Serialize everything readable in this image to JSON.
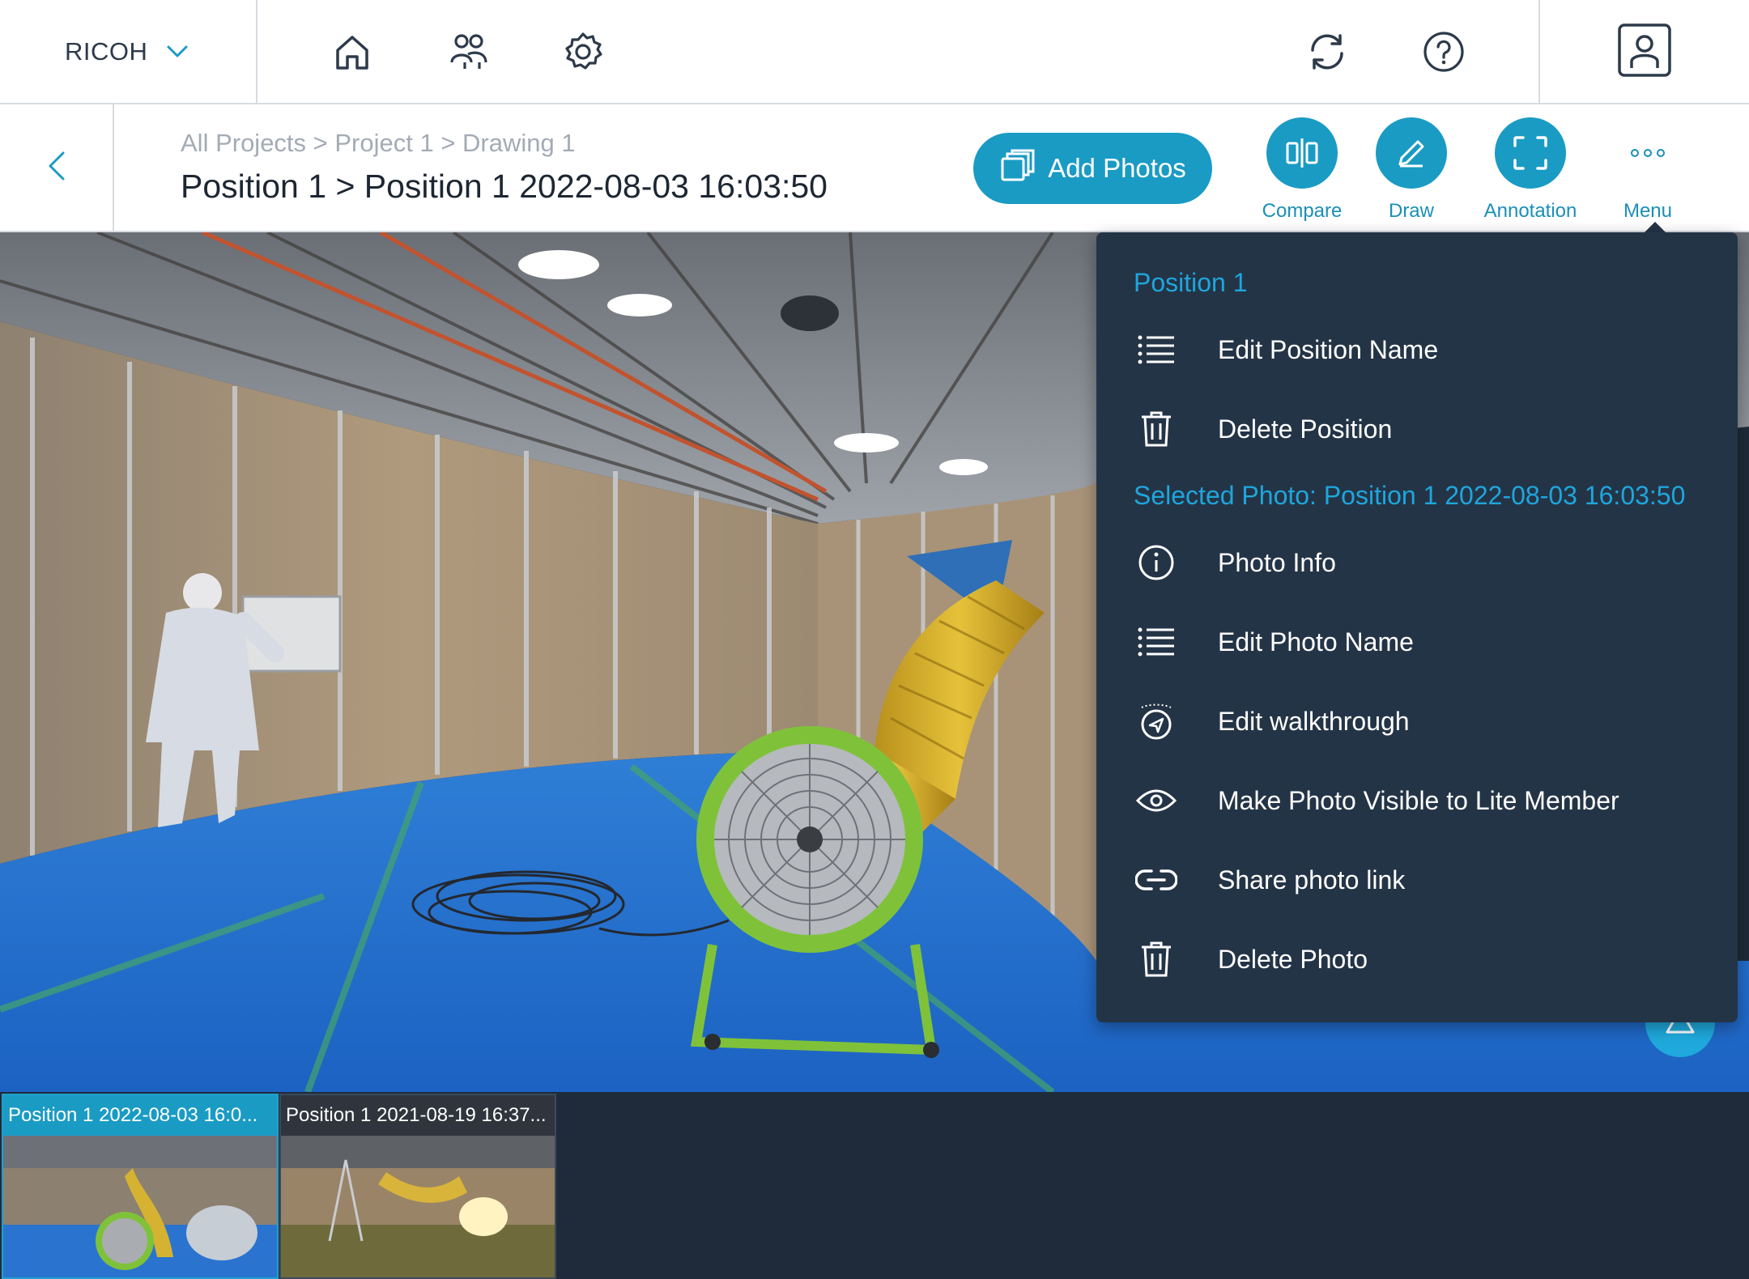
{
  "topbar": {
    "brand": "RICOH",
    "icons": [
      "home-icon",
      "people-icon",
      "settings-icon",
      "sync-icon",
      "help-icon",
      "user-icon"
    ]
  },
  "header": {
    "breadcrumb": "All Projects > Project 1 > Drawing 1",
    "title": "Position 1 > Position 1 2022-08-03 16:03:50",
    "add_photos": "Add Photos",
    "tools": {
      "compare": "Compare",
      "draw": "Draw",
      "annotation": "Annotation",
      "menu": "Menu"
    }
  },
  "menu": {
    "section_position": "Position 1",
    "edit_position_name": "Edit Position Name",
    "delete_position": "Delete Position",
    "section_photo": "Selected Photo: Position 1 2022-08-03 16:03:50",
    "photo_info": "Photo Info",
    "edit_photo_name": "Edit Photo Name",
    "edit_walkthrough": "Edit walkthrough",
    "make_visible": "Make Photo Visible to Lite Member",
    "share_link": "Share photo link",
    "delete_photo": "Delete Photo"
  },
  "thumbnails": [
    {
      "caption": "Position 1 2022-08-03 16:0...",
      "selected": true
    },
    {
      "caption": "Position 1 2021-08-19 16:37...",
      "selected": false
    }
  ],
  "colors": {
    "accent": "#1a9bc4",
    "menu_bg": "#243447",
    "section_text": "#1ea6dc"
  }
}
